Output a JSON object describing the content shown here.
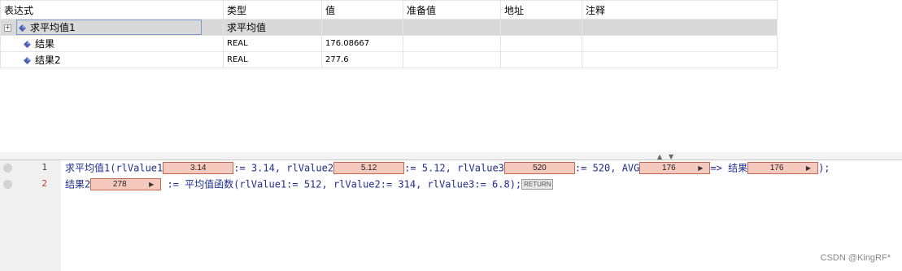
{
  "watch": {
    "headers": [
      "表达式",
      "类型",
      "值",
      "准备值",
      "地址",
      "注释"
    ],
    "rows": [
      {
        "expand": "+",
        "name": "求平均值1",
        "type": "求平均值",
        "value": "",
        "prepared": "",
        "address": "",
        "comment": ""
      },
      {
        "expand": "",
        "name": "结果",
        "type": "REAL",
        "value": "176.08667",
        "prepared": "",
        "address": "",
        "comment": ""
      },
      {
        "expand": "",
        "name": "结果2",
        "type": "REAL",
        "value": "277.6",
        "prepared": "",
        "address": "",
        "comment": ""
      }
    ]
  },
  "editor": {
    "line_numbers": [
      "1",
      "2"
    ],
    "line1": {
      "t1": "求平均值1(rlValue1",
      "iv1": "3.14",
      "t2": ":= 3.14, rlValue2",
      "iv2": "5.12",
      "t3": ":= 5.12, rlValue3",
      "iv3": "520",
      "t4": ":= 520, AVG",
      "iv4": "176",
      "t5": "=> 结果",
      "iv5": "176",
      "t6": ");"
    },
    "line2": {
      "t1": "结果2",
      "iv1": "278",
      "t2": " := 平均值函数(rlValue1:= 512, rlValue2:= 314, rlValue3:= 6.8);",
      "ret": "RETURN"
    }
  },
  "watermark": "CSDN @KingRF*",
  "colors": {
    "inline_value_bg": "#f6c9be",
    "inline_value_border": "#c06a55",
    "code_text": "#1f2d8f",
    "selected_row": "#d9d9d9"
  }
}
